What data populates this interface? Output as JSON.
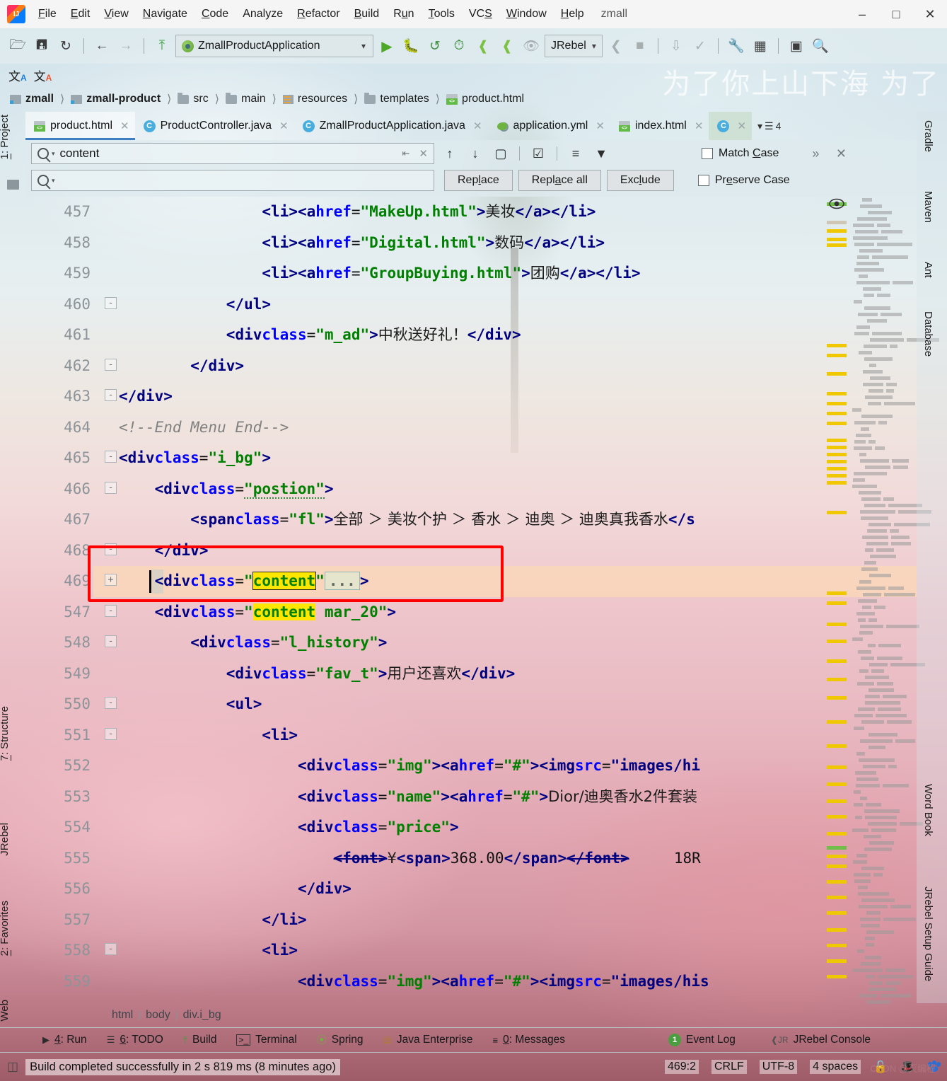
{
  "window": {
    "project_name": "zmall",
    "minimize": "–",
    "maximize": "□",
    "close": "✕"
  },
  "menu": [
    "File",
    "Edit",
    "View",
    "Navigate",
    "Code",
    "Analyze",
    "Refactor",
    "Build",
    "Run",
    "Tools",
    "VCS",
    "Window",
    "Help"
  ],
  "toolbar": {
    "run_config": "ZmallProductApplication",
    "jrebel_label": "JRebel",
    "open_icon": "open-folder-icon",
    "save_icon": "save-icon",
    "sync_icon": "sync-icon",
    "back_icon": "back-arrow-icon",
    "forward_icon": "forward-arrow-icon",
    "build_icon": "build-hammer-icon",
    "run_icon": "run-play-icon",
    "debug_icon": "debug-icon",
    "rerun_icon": "rerun-icon",
    "profile_icon": "profile-icon",
    "jrebel_run_icon": "jrebel-run-icon",
    "jrebel_debug_icon": "jrebel-debug-icon",
    "coverage_icon": "coverage-icon",
    "stop_icon": "stop-icon",
    "settings_icon": "settings-wrench-icon",
    "struct_icon": "project-structure-icon",
    "layout_icon": "layout-icon",
    "search_icon": "search-everywhere-icon"
  },
  "watermark": "为了你上山下海  为了",
  "breadcrumb": [
    {
      "label": "zmall",
      "icon": "module-icon",
      "bold": true
    },
    {
      "label": "zmall-product",
      "icon": "module-icon",
      "bold": true
    },
    {
      "label": "src",
      "icon": "folder-icon",
      "bold": false
    },
    {
      "label": "main",
      "icon": "folder-icon",
      "bold": false
    },
    {
      "label": "resources",
      "icon": "resources-folder-icon",
      "bold": false
    },
    {
      "label": "templates",
      "icon": "folder-icon",
      "bold": false
    },
    {
      "label": "product.html",
      "icon": "html-file-icon",
      "bold": false
    }
  ],
  "tabs": [
    {
      "label": "product.html",
      "icon": "html-file-icon",
      "active": true
    },
    {
      "label": "ProductController.java",
      "icon": "java-class-icon",
      "active": false
    },
    {
      "label": "ZmallProductApplication.java",
      "icon": "spring-boot-class-icon",
      "active": false
    },
    {
      "label": "application.yml",
      "icon": "spring-yaml-icon",
      "active": false
    },
    {
      "label": "index.html",
      "icon": "html-file-icon",
      "active": false
    },
    {
      "label": "",
      "icon": "java-class-icon",
      "active": false
    }
  ],
  "tab_overflow_count": "4",
  "find": {
    "search_value": "content",
    "replace_value": "",
    "replace_placeholder": "",
    "buttons": {
      "replace": "Replace",
      "replace_all": "Replace all",
      "exclude": "Exclude"
    },
    "match_case": "Match Case",
    "preserve_case": "Preserve Case",
    "match_case_checked": false,
    "preserve_case_checked": false,
    "icons": {
      "prev": "arrow-up-icon",
      "next": "arrow-down-icon",
      "select_all": "select-all-occurrences-icon",
      "in_selection": "in-selection-icon",
      "preserve": "preserve-case-icon",
      "filter": "filter-icon",
      "expand": "expand-more-icon",
      "close": "close-icon"
    }
  },
  "editor": {
    "lines": [
      {
        "n": "457",
        "indent": 16,
        "fold": "",
        "html": "&lt;li&gt;&lt;a href=\"MakeUp.html\"&gt;美妆&lt;/a&gt;&lt;/li&gt;"
      },
      {
        "n": "458",
        "indent": 16,
        "fold": "",
        "html": "&lt;li&gt;&lt;a href=\"Digital.html\"&gt;数码&lt;/a&gt;&lt;/li&gt;"
      },
      {
        "n": "459",
        "indent": 16,
        "fold": "",
        "html": "&lt;li&gt;&lt;a href=\"GroupBuying.html\"&gt;团购&lt;/a&gt;&lt;/li&gt;"
      },
      {
        "n": "460",
        "indent": 12,
        "fold": "-",
        "html": "&lt;/ul&gt;"
      },
      {
        "n": "461",
        "indent": 12,
        "fold": "",
        "html": "&lt;div class=\"m_ad\"&gt;中秋送好礼！&lt;/div&gt;"
      },
      {
        "n": "462",
        "indent": 8,
        "fold": "-",
        "html": "&lt;/div&gt;"
      },
      {
        "n": "463",
        "indent": 0,
        "fold": "-",
        "html": "&lt;/div&gt;"
      },
      {
        "n": "464",
        "indent": 0,
        "fold": "",
        "html": "&lt;!--End Menu End--&gt;"
      },
      {
        "n": "465",
        "indent": 0,
        "fold": "-",
        "html": "&lt;div class=\"i_bg\"&gt;"
      },
      {
        "n": "466",
        "indent": 4,
        "fold": "-",
        "html": "&lt;div class=\"postion\"&gt;"
      },
      {
        "n": "467",
        "indent": 8,
        "fold": "",
        "html": "&lt;span class=\"fl\"&gt;全部 ＞ 美妆个护 ＞ 香水 ＞ 迪奥 ＞ 迪奥真我香水&lt;/s"
      },
      {
        "n": "468",
        "indent": 4,
        "fold": "-",
        "html": "&lt;/div&gt;"
      },
      {
        "n": "469",
        "indent": 4,
        "fold": "+",
        "html": "&lt;div class=\"content\"...&gt;"
      },
      {
        "n": "547",
        "indent": 4,
        "fold": "-",
        "html": "&lt;div class=\"content mar_20\"&gt;"
      },
      {
        "n": "548",
        "indent": 8,
        "fold": "-",
        "html": "&lt;div class=\"l_history\"&gt;"
      },
      {
        "n": "549",
        "indent": 12,
        "fold": "",
        "html": "&lt;div class=\"fav_t\"&gt;用户还喜欢&lt;/div&gt;"
      },
      {
        "n": "550",
        "indent": 12,
        "fold": "-",
        "html": "&lt;ul&gt;"
      },
      {
        "n": "551",
        "indent": 16,
        "fold": "-",
        "html": "&lt;li&gt;"
      },
      {
        "n": "552",
        "indent": 20,
        "fold": "",
        "html": "&lt;div class=\"img\"&gt;&lt;a href=\"#\"&gt;&lt;img src=\"images/hi"
      },
      {
        "n": "553",
        "indent": 20,
        "fold": "",
        "html": "&lt;div class=\"name\"&gt;&lt;a href=\"#\"&gt;Dior/迪奥香水2件套装"
      },
      {
        "n": "554",
        "indent": 20,
        "fold": "",
        "html": "&lt;div class=\"price\"&gt;"
      },
      {
        "n": "555",
        "indent": 24,
        "fold": "",
        "html": "&lt;font&gt;¥&lt;span&gt;368.00&lt;/span&gt;&lt;/font&gt;     18R"
      },
      {
        "n": "556",
        "indent": 20,
        "fold": "",
        "html": "&lt;/div&gt;"
      },
      {
        "n": "557",
        "indent": 16,
        "fold": "",
        "html": "&lt;/li&gt;"
      },
      {
        "n": "558",
        "indent": 16,
        "fold": "-",
        "html": "&lt;li&gt;"
      },
      {
        "n": "559",
        "indent": 20,
        "fold": "",
        "html": "&lt;div class=\"img\"&gt;&lt;a href=\"#\"&gt;&lt;img src=\"images/his"
      }
    ],
    "highlight_term": "content",
    "caret_line": "469",
    "annotation_box": "red-highlight-rectangle"
  },
  "left_tool_window": [
    {
      "label": "1: Project",
      "shortcut": "1"
    },
    {
      "label": "7: Structure",
      "shortcut": "7"
    },
    {
      "label": "JRebel",
      "shortcut": ""
    },
    {
      "label": "2: Favorites",
      "shortcut": "2"
    },
    {
      "label": "Web",
      "shortcut": ""
    }
  ],
  "right_tool_window": [
    {
      "label": "Gradle",
      "icon": "gradle-icon"
    },
    {
      "label": "Maven",
      "icon": "maven-icon"
    },
    {
      "label": "Ant",
      "icon": "ant-icon"
    },
    {
      "label": "Database",
      "icon": "database-icon"
    },
    {
      "label": "Word Book",
      "icon": "wordbook-icon"
    },
    {
      "label": "JRebel Setup Guide",
      "icon": "jrebel-icon"
    }
  ],
  "bottom_breadcrumb": [
    "html",
    "body",
    "div.i_bg"
  ],
  "bottom_tool_bar": [
    {
      "label": "4: Run",
      "icon": "run-icon",
      "underline": "4"
    },
    {
      "label": "6: TODO",
      "icon": "todo-icon",
      "underline": "6"
    },
    {
      "label": "Build",
      "icon": "build-icon",
      "underline": ""
    },
    {
      "label": "Terminal",
      "icon": "terminal-icon",
      "underline": ""
    },
    {
      "label": "Spring",
      "icon": "spring-icon",
      "underline": ""
    },
    {
      "label": "Java Enterprise",
      "icon": "java-ee-icon",
      "underline": ""
    },
    {
      "label": "0: Messages",
      "icon": "messages-icon",
      "underline": "0"
    },
    {
      "label": "Event Log",
      "icon": "event-log-icon",
      "underline": "",
      "badge": "1"
    },
    {
      "label": "JRebel Console",
      "icon": "jrebel-console-icon",
      "underline": ""
    }
  ],
  "status_bar": {
    "message": "Build completed successfully in 2 s 819 ms (8 minutes ago)",
    "caret_position": "469:2",
    "line_separator": "CRLF",
    "encoding": "UTF-8",
    "indent": "4 spaces",
    "lock_icon": "unlock-icon",
    "hat_icon": "hector-icon",
    "baidu_icon": "baidu-paw-icon"
  },
  "watermark_credit": "CSDN @灭编程",
  "colors": {
    "tag": "#000080",
    "attribute": "#0000ff",
    "string": "#008000",
    "comment": "#808080",
    "search_highlight": "#ffe600",
    "annotation_box": "#ff0000",
    "accent": "#3e7fc1",
    "marker_yellow": "#f0c800",
    "marker_green": "#6fbf4a"
  }
}
